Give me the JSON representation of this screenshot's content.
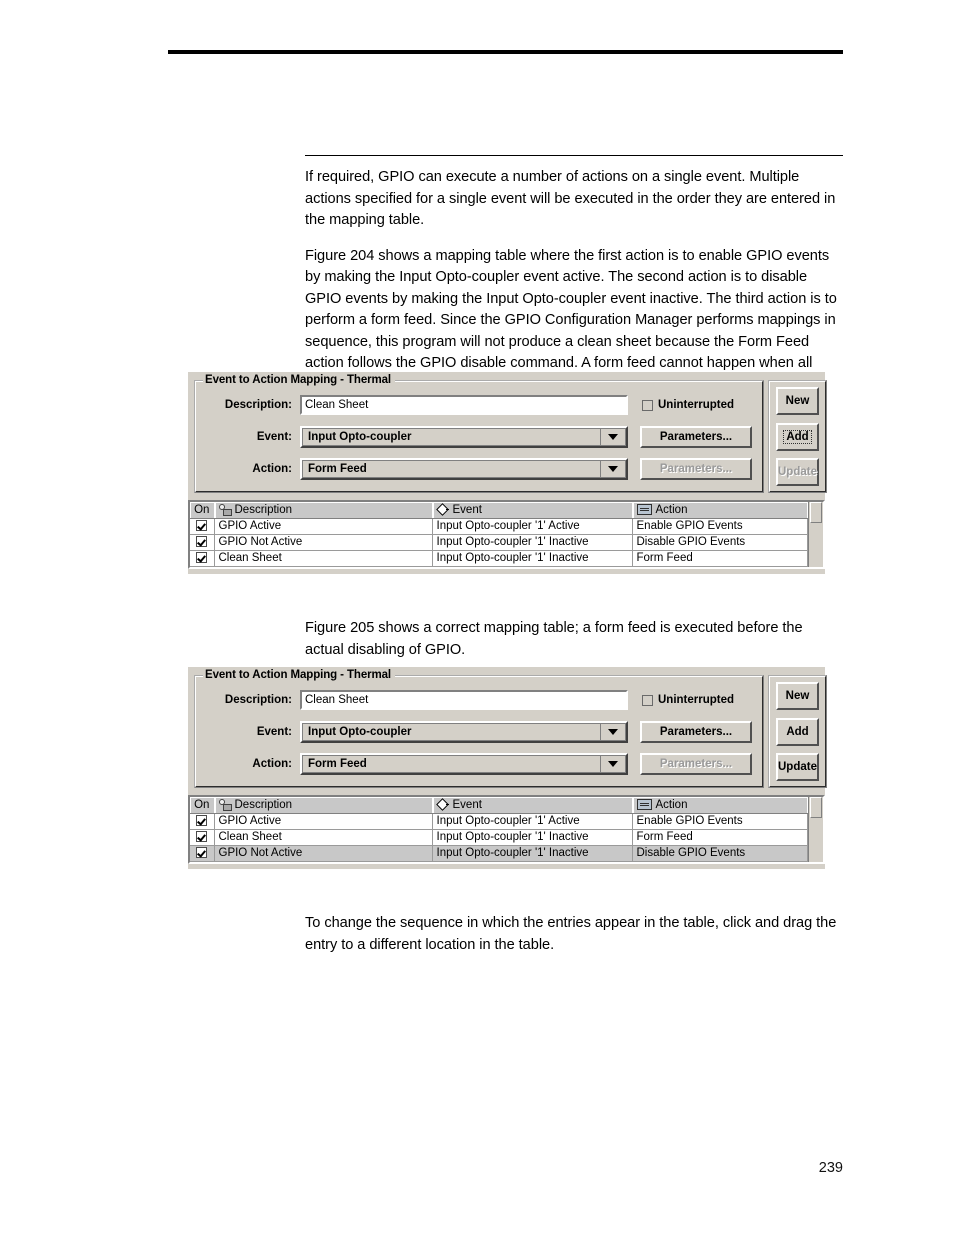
{
  "page": {
    "number": "239"
  },
  "prose": {
    "para1": "If required, GPIO can execute a number of actions on a single event. Multiple actions specified for a single event will be executed in the order they are entered in the mapping table.",
    "para2": "Figure 204 shows a mapping table where the first action is to enable GPIO events by making the Input Opto-coupler event active. The second action is to disable GPIO events by making the Input Opto-coupler event inactive. The third action is to perform a form feed. Since the GPIO Configuration Manager performs mappings in sequence, this program will not produce a clean sheet because the Form Feed action follows the GPIO disable command. A form feed cannot happen when all GPIO events are disabled first.",
    "para3": "Figure 205 shows a correct mapping table; a form feed is executed before the actual disabling of GPIO.",
    "para4": "To change the sequence in which the entries appear in the table, click and drag the entry to a different location in the table."
  },
  "dialog1": {
    "group_title": "Event to Action Mapping - Thermal",
    "labels": {
      "description": "Description:",
      "event": "Event:",
      "action": "Action:"
    },
    "description_value": "Clean Sheet",
    "description_placeholder": "",
    "event_value": "Input Opto-coupler",
    "action_value": "Form Feed",
    "uninterrupted_label": "Uninterrupted",
    "uninterrupted_checked": false,
    "event_params_label": "Parameters...",
    "action_params_label": "Parameters...",
    "buttons": {
      "new": "New",
      "add": "Add",
      "update": "Update"
    },
    "table": {
      "headers": {
        "on": "On",
        "description": "Description",
        "event": "Event",
        "action": "Action"
      },
      "rows": [
        {
          "on": true,
          "description": "GPIO Active",
          "event": "Input Opto-coupler '1' Active",
          "action": "Enable GPIO Events",
          "selected": false
        },
        {
          "on": true,
          "description": "GPIO Not Active",
          "event": "Input Opto-coupler '1' Inactive",
          "action": "Disable GPIO Events",
          "selected": false
        },
        {
          "on": true,
          "description": "Clean Sheet",
          "event": "Input Opto-coupler '1' Inactive",
          "action": "Form Feed",
          "selected": false
        }
      ]
    }
  },
  "dialog2": {
    "group_title": "Event to Action Mapping - Thermal",
    "labels": {
      "description": "Description:",
      "event": "Event:",
      "action": "Action:"
    },
    "description_value": "Clean Sheet",
    "description_placeholder": "",
    "event_value": "Input Opto-coupler",
    "action_value": "Form Feed",
    "uninterrupted_label": "Uninterrupted",
    "uninterrupted_checked": false,
    "event_params_label": "Parameters...",
    "action_params_label": "Parameters...",
    "buttons": {
      "new": "New",
      "add": "Add",
      "update": "Update"
    },
    "table": {
      "headers": {
        "on": "On",
        "description": "Description",
        "event": "Event",
        "action": "Action"
      },
      "rows": [
        {
          "on": true,
          "description": "GPIO Active",
          "event": "Input Opto-coupler '1' Active",
          "action": "Enable GPIO Events",
          "selected": false
        },
        {
          "on": true,
          "description": "Clean Sheet",
          "event": "Input Opto-coupler '1' Inactive",
          "action": "Form Feed",
          "selected": false
        },
        {
          "on": true,
          "description": "GPIO Not Active",
          "event": "Input Opto-coupler '1' Inactive",
          "action": "Disable GPIO Events",
          "selected": true
        }
      ]
    }
  }
}
